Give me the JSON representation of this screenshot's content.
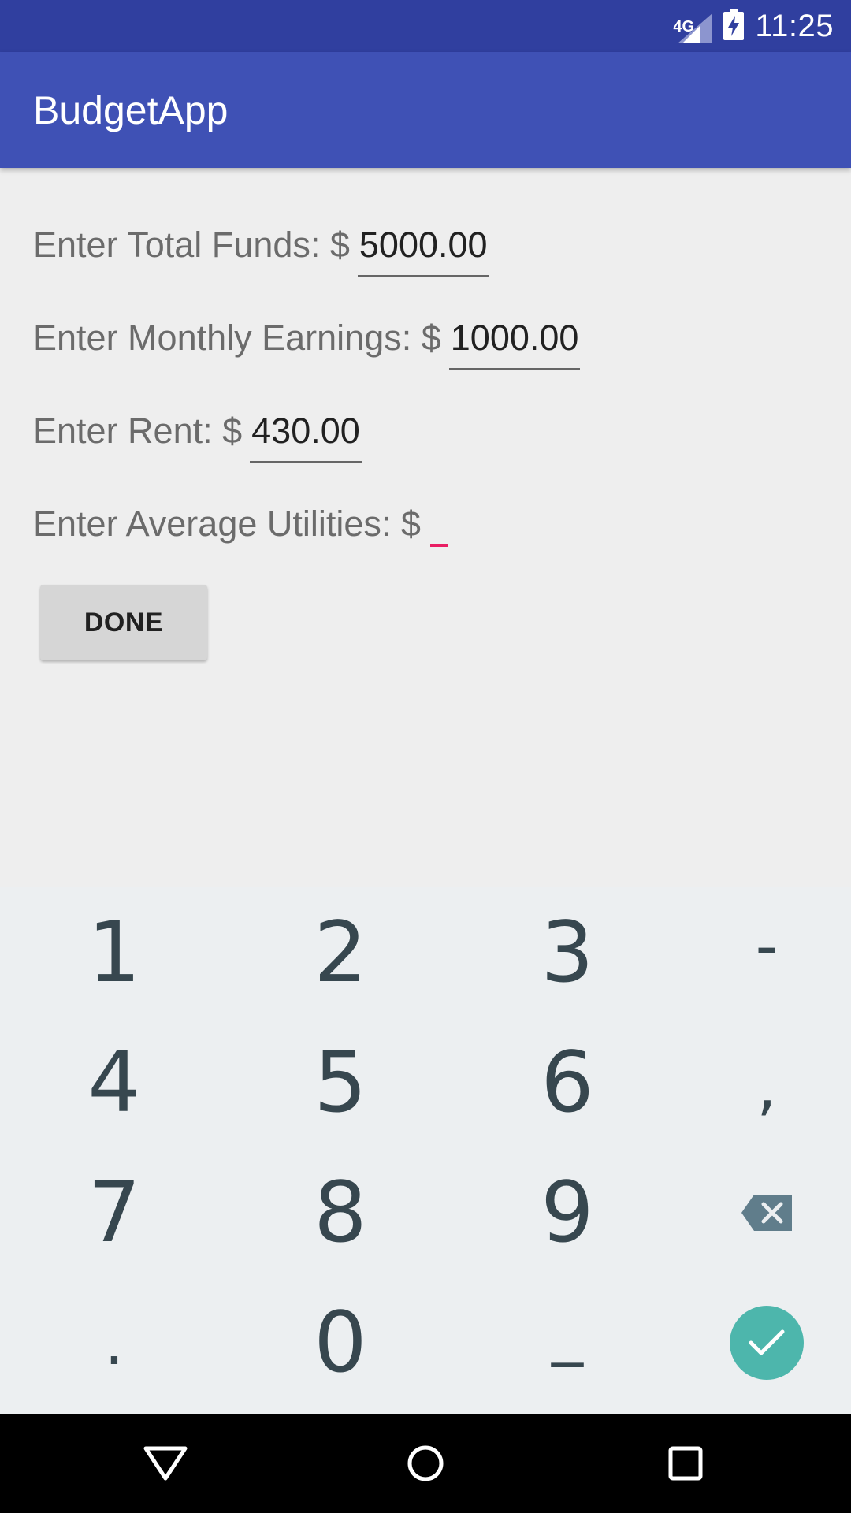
{
  "status_bar": {
    "network": "4G",
    "time": "11:25"
  },
  "app_bar": {
    "title": "BudgetApp"
  },
  "form": {
    "total_funds_label": "Enter Total Funds: $",
    "total_funds_value": "5000.00",
    "monthly_earnings_label": "Enter Monthly Earnings: $",
    "monthly_earnings_value": "1000.00",
    "rent_label": "Enter Rent: $",
    "rent_value": "430.00",
    "utilities_label": "Enter Average Utilities: $",
    "utilities_value": "",
    "done_label": "DONE"
  },
  "keyboard": {
    "keys": [
      "1",
      "2",
      "3",
      "-",
      "4",
      "5",
      "6",
      ",",
      "7",
      "8",
      "9",
      ".",
      "0",
      "_"
    ],
    "icons": {
      "backspace": "backspace-icon",
      "enter": "check-icon"
    },
    "accent_color": "#4db6ac"
  },
  "nav_bar": {
    "icons": [
      "back-triangle-icon",
      "home-circle-icon",
      "recents-square-icon"
    ]
  },
  "colors": {
    "status_bar": "#303f9f",
    "app_bar": "#3f51b5",
    "cursor": "#e91e63"
  }
}
